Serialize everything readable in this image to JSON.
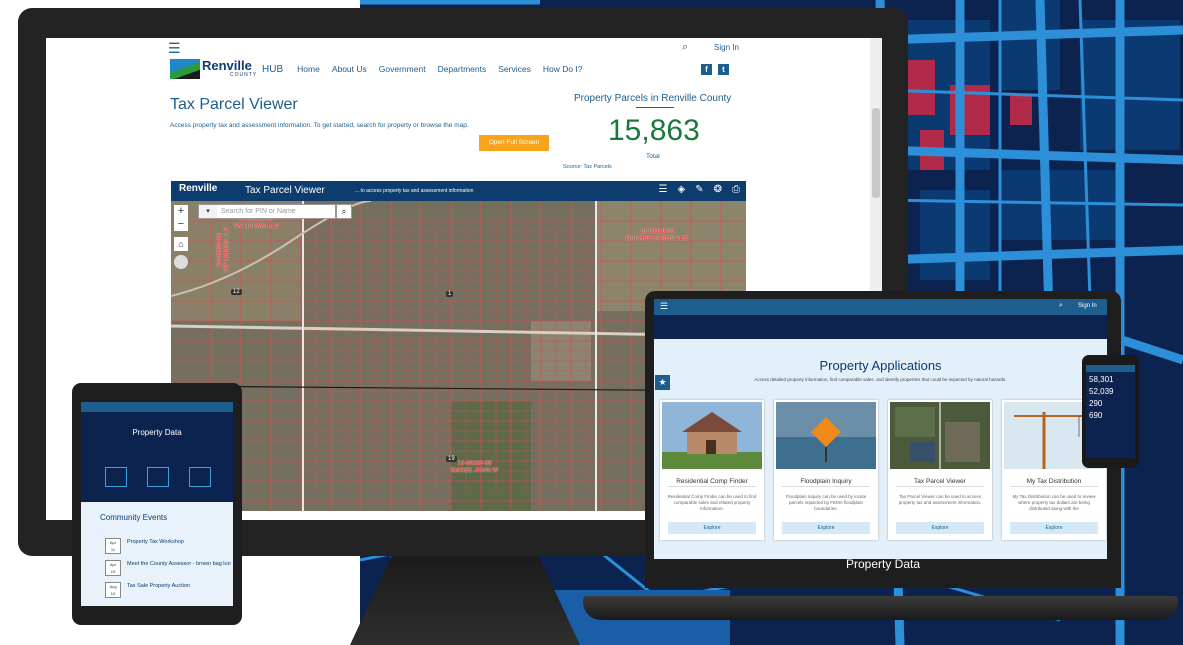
{
  "site": {
    "menu_icon": "☰",
    "search_icon": "⌕",
    "sign_in": "Sign In",
    "logo_name": "Renville",
    "logo_county": "COUNTY",
    "nav": [
      "HUB",
      "Home",
      "About Us",
      "Government",
      "Departments",
      "Services",
      "How Do I?"
    ],
    "social": [
      "f",
      "t"
    ]
  },
  "page": {
    "title": "Tax Parcel Viewer",
    "description": "Access property tax and assessment information. To get started, search for property or browse the map.",
    "fullscreen_button": "Open Full Screen"
  },
  "stat": {
    "title": "Property Parcels in Renville County",
    "value": "15,863",
    "label": "Total",
    "source": "Source: Tax Parcels"
  },
  "map_app": {
    "logo": "Renville",
    "title": "Tax Parcel Viewer",
    "subtitle": "... to access property tax and assessment information",
    "search_placeholder": "Search for PIN or Name",
    "zoom_in": "+",
    "zoom_out": "−",
    "parcel_labels": [
      {
        "text": "10-00940-00\nTW HARMS LLP"
      },
      {
        "text": "10-00810-00\nBRUHNS FARMS LLC"
      },
      {
        "text": "10-00939-00\nTW HARMS LLP"
      },
      {
        "text": "10-00420-00\nEMDEE JOHN W"
      }
    ],
    "road_labels": [
      "12",
      "1",
      "19"
    ]
  },
  "tablet": {
    "title": "Property Data",
    "events_title": "Community Events",
    "events": [
      {
        "month": "Apr",
        "day": "11",
        "name": "Property Tax Workshop"
      },
      {
        "month": "Apr",
        "day": "19",
        "name": "Meet the County Assessor - brown bag lun"
      },
      {
        "month": "Aug",
        "day": "10",
        "name": "Tax Sale Property Auction"
      }
    ]
  },
  "laptop": {
    "sign_in": "Sign In",
    "heading": "Property Applications",
    "subheading": "Access detailed property information, find comparable sales, and identify properties that could be impacted by natural hazards.",
    "cards": [
      {
        "title": "Residential Comp Finder",
        "desc": "Residential Comp Finder can be used to find comparable sales and related property information.",
        "button": "Explore"
      },
      {
        "title": "Floodplain Inquiry",
        "desc": "Floodplain Inquiry can be used by locate parcels impacted by FEMA floodplain boundaries.",
        "button": "Explore"
      },
      {
        "title": "Tax Parcel Viewer",
        "desc": "Tax Parcel Viewer can be used to access property tax and assessment information.",
        "button": "Explore"
      },
      {
        "title": "My Tax Distribution",
        "desc": "My Tax Distribution can be used to review where property tax dollars are being distributed along with the",
        "button": "Explore"
      }
    ],
    "footer": "Property Data"
  },
  "phone": {
    "stats": [
      {
        "value": "58,301"
      },
      {
        "value": "52,039"
      },
      {
        "value": "290"
      },
      {
        "value": "690"
      }
    ]
  },
  "colors": {
    "brand_blue": "#1d5e8e",
    "navy": "#0c2350",
    "accent_orange": "#f7a31c",
    "stat_green": "#1a7a3c",
    "parcel_red": "#e63b3b"
  }
}
